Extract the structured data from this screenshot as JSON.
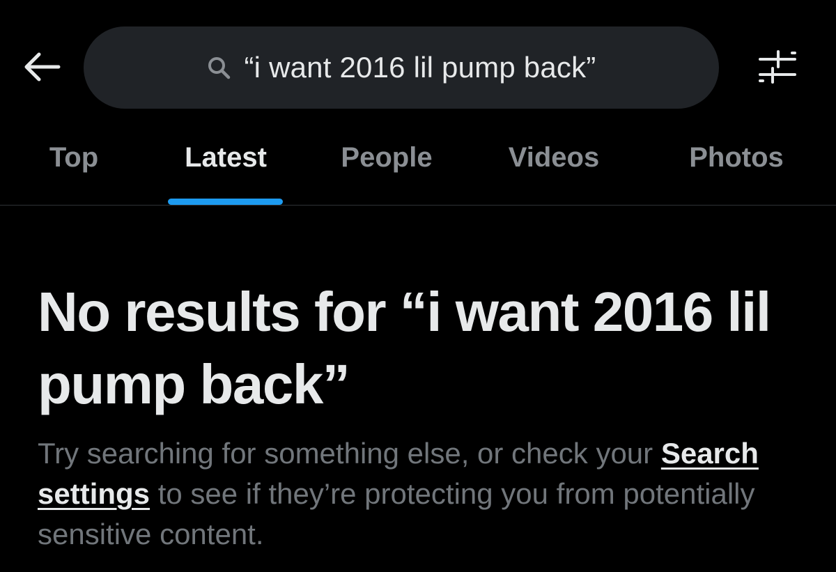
{
  "header": {
    "back_icon": "arrow-left-icon",
    "search": {
      "icon": "search-icon",
      "value": "“i want 2016 lil pump back”"
    },
    "filter_icon": "sliders-icon"
  },
  "tabs": [
    {
      "label": "Top",
      "active": false
    },
    {
      "label": "Latest",
      "active": true
    },
    {
      "label": "People",
      "active": false
    },
    {
      "label": "Videos",
      "active": false
    },
    {
      "label": "Photos",
      "active": false
    }
  ],
  "empty_state": {
    "title": "No results for “i want 2016 lil pump back”",
    "body_before_link": "Try searching for something else, or check your ",
    "link_label": "Search settings",
    "body_after_link": " to see if they’re protecting you from potentially sensitive content."
  },
  "colors": {
    "background": "#000000",
    "search_box": "#202327",
    "accent": "#1d9bf0",
    "primary_text": "#e7e9ea",
    "secondary_text": "#71767b"
  }
}
